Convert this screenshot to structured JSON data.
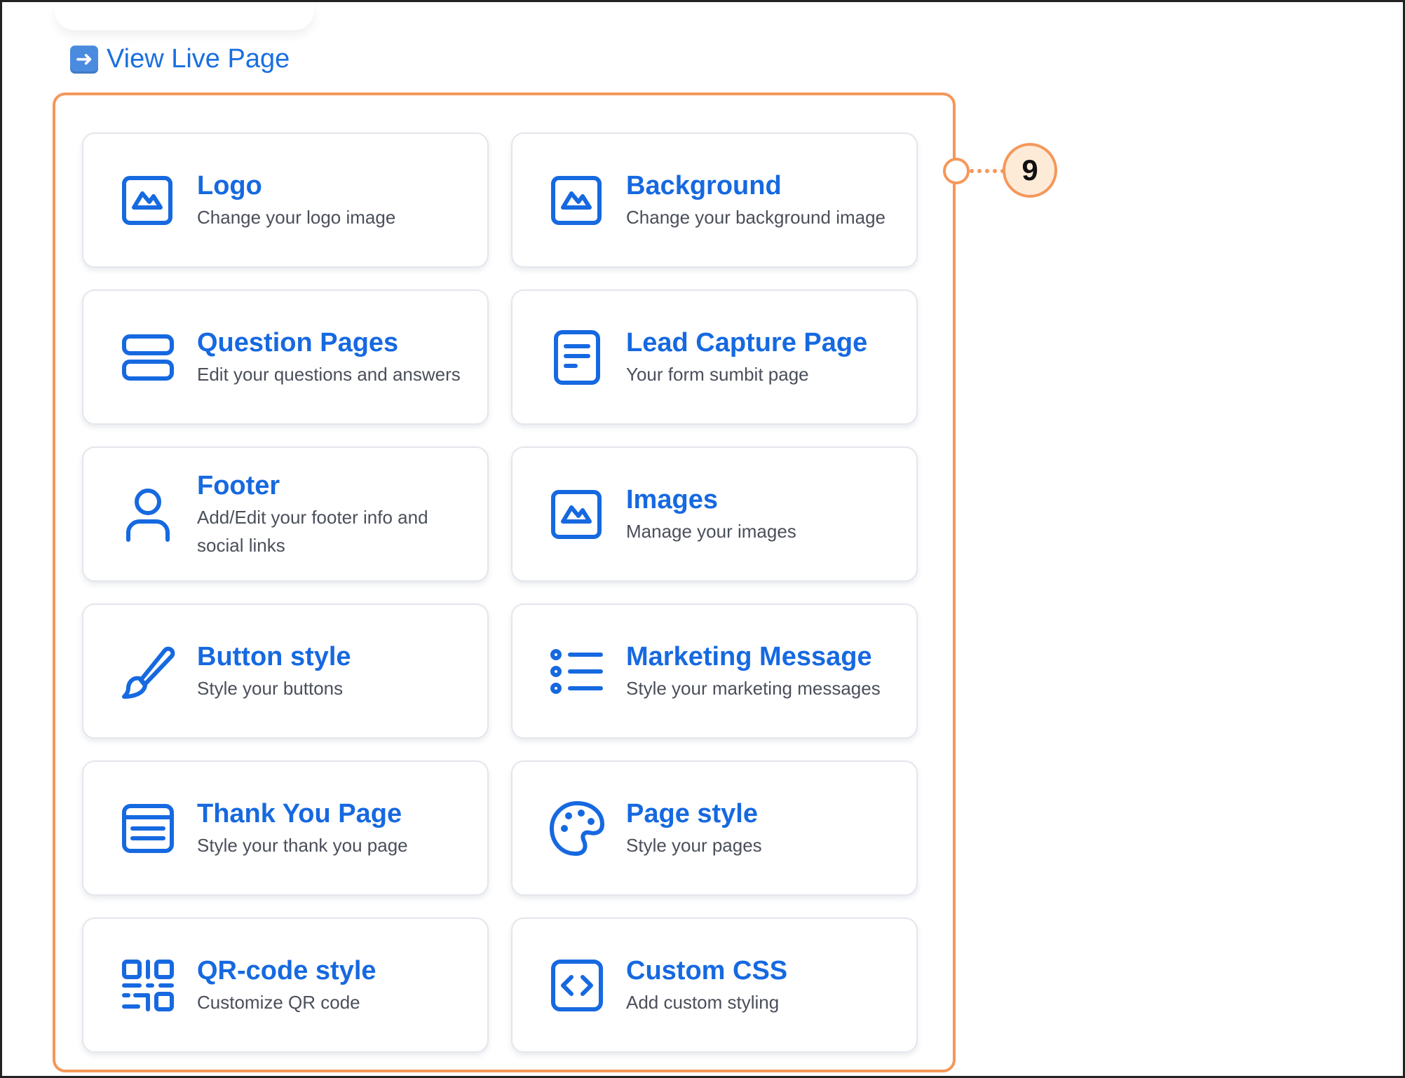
{
  "view_live": {
    "label": "View Live Page",
    "icon": "arrow-right-icon"
  },
  "callout": {
    "number": "9"
  },
  "colors": {
    "accent": "#1669e0",
    "highlight": "#f5975a",
    "callout_fill": "#fdebd8"
  },
  "cards": [
    {
      "title": "Logo",
      "desc": "Change your logo image",
      "icon": "image-icon"
    },
    {
      "title": "Background",
      "desc": "Change your background image",
      "icon": "image-icon"
    },
    {
      "title": "Question Pages",
      "desc": "Edit your questions and answers",
      "icon": "stacked-rows-icon"
    },
    {
      "title": "Lead Capture Page",
      "desc": "Your form sumbit page",
      "icon": "form-document-icon"
    },
    {
      "title": "Footer",
      "desc": "Add/Edit your footer info and social links",
      "icon": "user-icon"
    },
    {
      "title": "Images",
      "desc": "Manage your images",
      "icon": "image-icon"
    },
    {
      "title": "Button style",
      "desc": "Style your buttons",
      "icon": "paintbrush-icon"
    },
    {
      "title": "Marketing Message",
      "desc": "Style your marketing messages",
      "icon": "list-icon"
    },
    {
      "title": "Thank You Page",
      "desc": "Style your thank you page",
      "icon": "page-layout-icon"
    },
    {
      "title": "Page style",
      "desc": "Style your pages",
      "icon": "palette-icon"
    },
    {
      "title": "QR-code style",
      "desc": "Customize QR code",
      "icon": "qr-code-icon"
    },
    {
      "title": "Custom CSS",
      "desc": "Add custom styling",
      "icon": "code-icon"
    }
  ]
}
